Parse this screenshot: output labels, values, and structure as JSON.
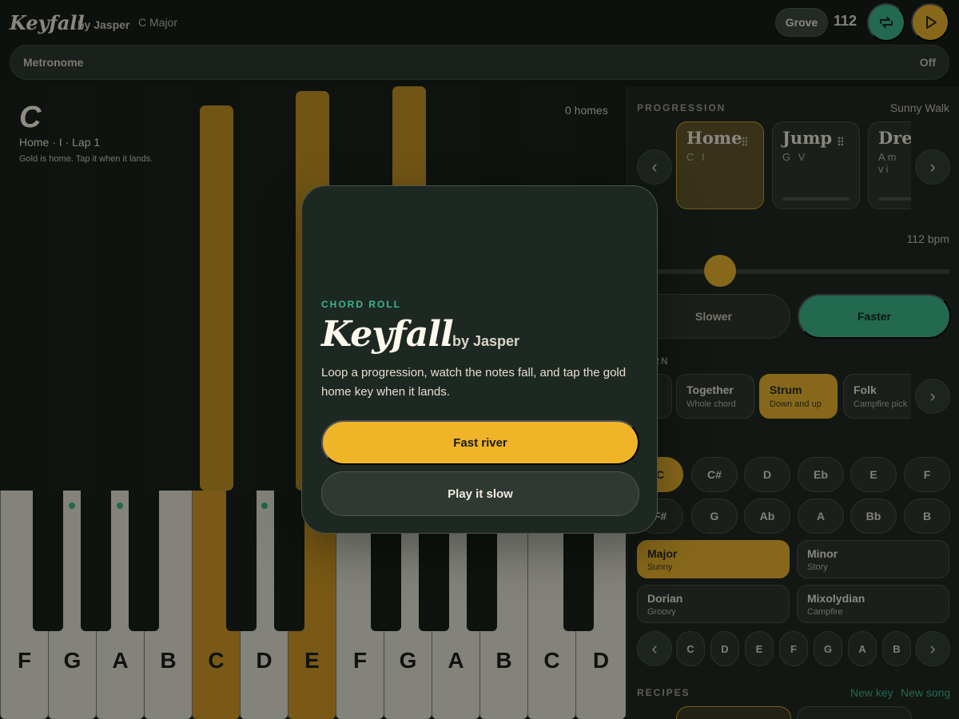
{
  "header": {
    "title": "Keyfall",
    "by": "by Jasper",
    "key": "C Major",
    "preset": "Grove",
    "bpm": "112"
  },
  "metronome": {
    "label": "Metronome",
    "state": "Off"
  },
  "note": {
    "letter": "C",
    "meta": "Home · I · Lap 1",
    "help": "Gold is home. Tap it when it lands.",
    "homes": "0 homes"
  },
  "keyboard": {
    "white_keys": [
      "F",
      "G",
      "A",
      "B",
      "C",
      "D",
      "E",
      "F",
      "G",
      "A",
      "B",
      "C",
      "D"
    ]
  },
  "progression": {
    "label": "PROGRESSION",
    "name": "Sunny Walk",
    "cards": [
      {
        "title": "Home",
        "chords": "C I"
      },
      {
        "title": "Jump",
        "chords": "G V"
      },
      {
        "title": "Drea",
        "chords": "Am vi"
      }
    ]
  },
  "tempo": {
    "label": "TEMPO",
    "visible_label": "PO",
    "value": "112 bpm",
    "slower": "Slower",
    "faster": "Faster"
  },
  "pattern": {
    "label": "PATTERN",
    "visible_label": "TERN",
    "items": [
      {
        "title": "Together",
        "sub": "Whole chord"
      },
      {
        "title": "Strum",
        "sub": "Down and up"
      },
      {
        "title": "Folk",
        "sub": "Campfire pick"
      }
    ]
  },
  "roots": {
    "row1": [
      "C",
      "C#",
      "D",
      "Eb",
      "E",
      "F"
    ],
    "row2": [
      "F#",
      "G",
      "Ab",
      "A",
      "Bb",
      "B"
    ]
  },
  "scales": [
    {
      "title": "Major",
      "sub": "Sunny"
    },
    {
      "title": "Minor",
      "sub": "Story"
    },
    {
      "title": "Dorian",
      "sub": "Groovy"
    },
    {
      "title": "Mixolydian",
      "sub": "Campfire"
    }
  ],
  "scale_keys": [
    "C",
    "D",
    "E",
    "F",
    "G",
    "A",
    "B"
  ],
  "recipes": {
    "label": "RECIPES",
    "new_key": "New key",
    "new_song": "New song"
  },
  "modal": {
    "eyebrow": "CHORD ROLL",
    "title": "Keyfall",
    "by": "by Jasper",
    "description": "Loop a progression, watch the notes fall, and tap the gold home key when it lands.",
    "fast": "Fast river",
    "slow": "Play it slow"
  },
  "colors": {
    "gold": "#f0b429",
    "green": "#39b68b",
    "dark": "#1e2823"
  }
}
